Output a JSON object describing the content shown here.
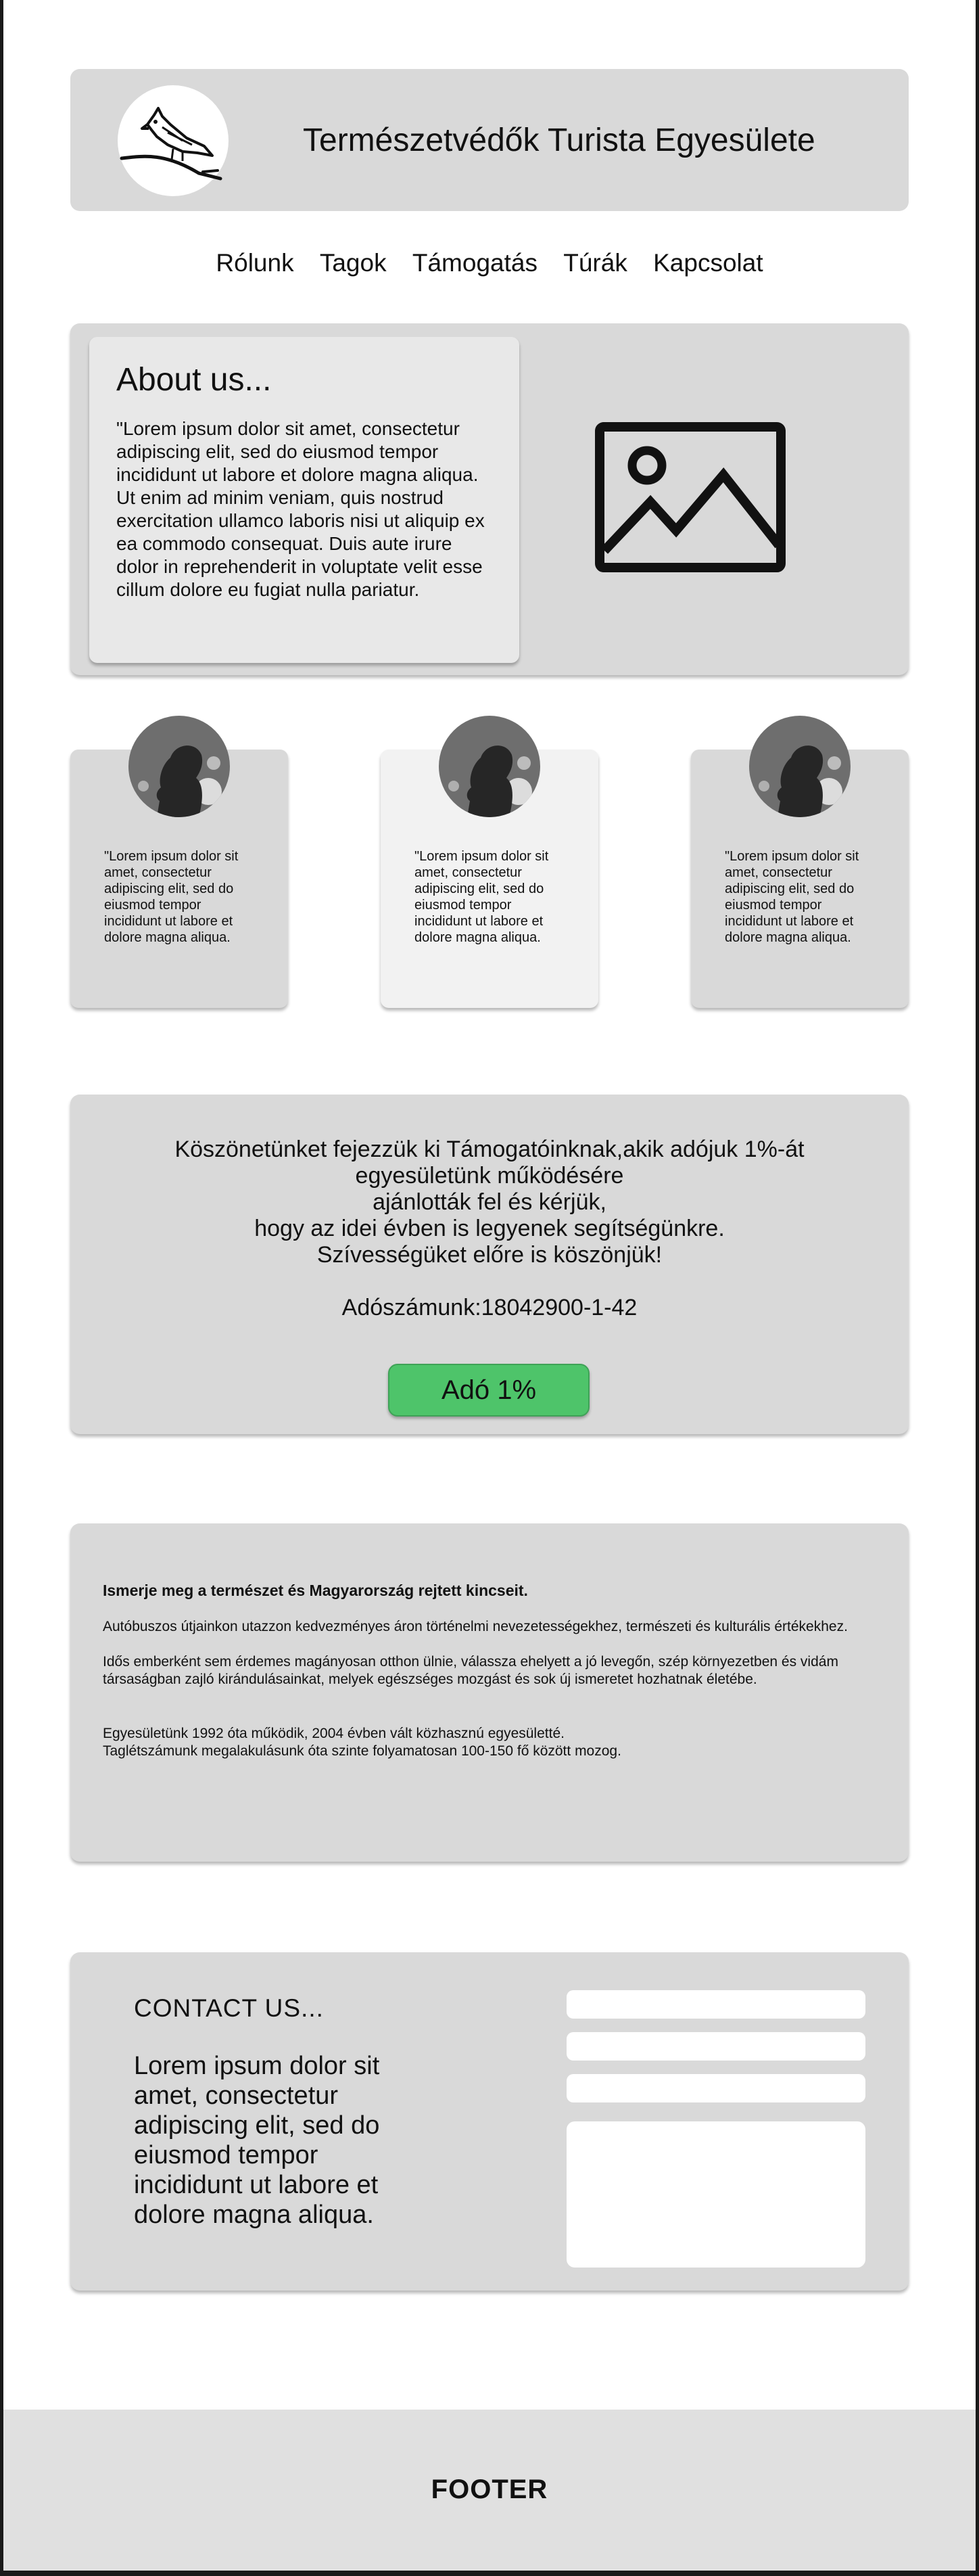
{
  "header": {
    "title": "Természetvédők Turista Egyesülete",
    "logo_icon": "bird-on-branch-icon"
  },
  "nav": {
    "items": [
      "Rólunk",
      "Tagok",
      "Támogatás",
      "Túrák",
      "Kapcsolat"
    ]
  },
  "about": {
    "title": "About us...",
    "text": "\"Lorem ipsum dolor sit amet, consectetur adipiscing elit, sed do eiusmod tempor incididunt ut labore et dolore magna aliqua. Ut enim ad minim veniam, quis nostrud exercitation ullamco laboris nisi ut aliquip ex ea commodo consequat. Duis aute irure dolor in reprehenderit in voluptate velit esse cillum dolore eu fugiat nulla pariatur.",
    "image_icon": "image-placeholder-icon"
  },
  "members": [
    {
      "text": "\"Lorem ipsum dolor sit amet, consectetur adipiscing elit, sed do eiusmod tempor incididunt ut labore et dolore magna aliqua."
    },
    {
      "text": "\"Lorem ipsum dolor sit amet, consectetur adipiscing elit, sed do eiusmod tempor incididunt ut labore et dolore magna aliqua."
    },
    {
      "text": "\"Lorem ipsum dolor sit amet, consectetur adipiscing elit, sed do eiusmod tempor incididunt ut labore et dolore magna aliqua."
    }
  ],
  "support": {
    "line1": "Köszönetünket fejezzük ki Támogatóinknak,akik adójuk 1%-át",
    "line2": "egyesületünk működésére",
    "line3": "ajánlották fel és kérjük,",
    "line4": "hogy az idei évben is legyenek segítségünkre.",
    "line5": "Szívességüket előre is köszönjük!",
    "tax_number": "Adószámunk:18042900-1-42",
    "button_label": "Adó 1%",
    "button_color": "#4ec46a"
  },
  "info": {
    "heading": "Ismerje meg a természet és Magyarország rejtett kincseit.",
    "p1": "Autóbuszos útjainkon utazzon kedvezményes áron történelmi nevezetességekhez, természeti és kulturális értékekhez.",
    "p2a": "Idős emberként sem érdemes magányosan otthon ülnie, válassza ehelyett a jó levegőn, szép környezetben és vidám",
    "p2b": "társaságban zajló kirándulásainkat, melyek egészséges mozgást és sok új ismeretet hozhatnak életébe.",
    "p3a": "Egyesületünk 1992 óta működik, 2004 évben vált közhasznú egyesületté.",
    "p3b": "Taglétszámunk megalakulásunk óta szinte folyamatosan 100-150 fő között mozog."
  },
  "contact": {
    "title": "CONTACT US...",
    "text": "Lorem ipsum dolor sit amet, consectetur adipiscing elit, sed do eiusmod tempor incididunt ut labore et dolore magna aliqua."
  },
  "footer": {
    "text": "FOOTER"
  }
}
